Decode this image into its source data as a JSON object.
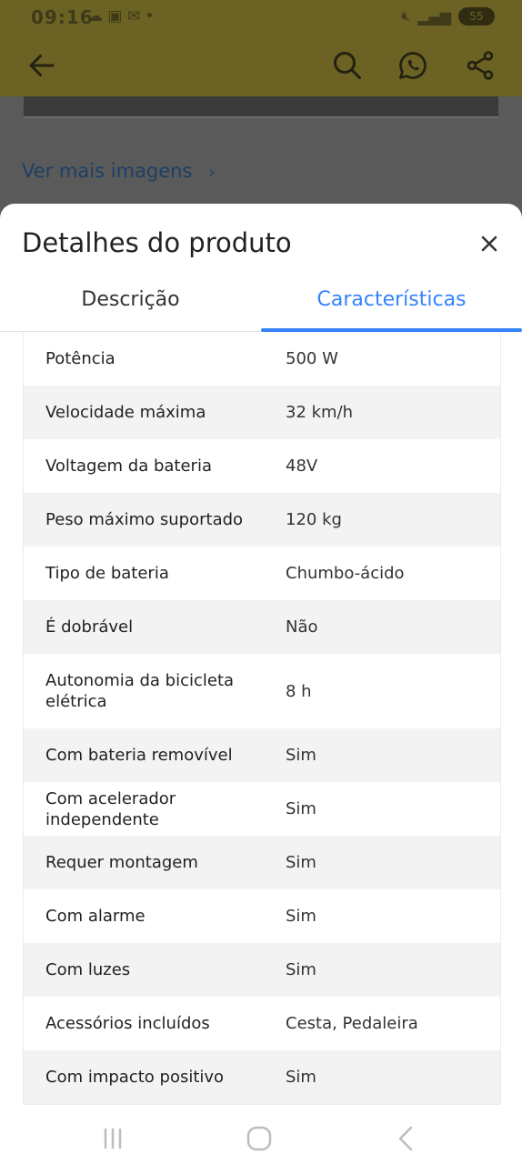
{
  "status_bar": {
    "time": "09:16",
    "notification_icons": [
      "cloud-icon",
      "image-icon",
      "mail-icon",
      "dot-icon"
    ],
    "battery": "55"
  },
  "app_bar": {
    "icons": [
      "back-arrow-icon",
      "search-icon",
      "whatsapp-icon",
      "share-icon"
    ]
  },
  "see_more_images": "Ver mais imagens",
  "sheet": {
    "title": "Detalhes do produto",
    "tabs": [
      {
        "label": "Descrição",
        "selected": false
      },
      {
        "label": "Características",
        "selected": true
      }
    ],
    "specs": [
      {
        "key": "Potência",
        "value": "500 W"
      },
      {
        "key": "Velocidade máxima",
        "value": "32 km/h"
      },
      {
        "key": "Voltagem da bateria",
        "value": "48V"
      },
      {
        "key": "Peso máximo suportado",
        "value": "120 kg"
      },
      {
        "key": "Tipo de bateria",
        "value": "Chumbo-ácido"
      },
      {
        "key": "É dobrável",
        "value": "Não"
      },
      {
        "key": "Autonomia da bicicleta elétrica",
        "value": "8 h"
      },
      {
        "key": "Com bateria removível",
        "value": "Sim"
      },
      {
        "key": "Com acelerador independente",
        "value": "Sim"
      },
      {
        "key": "Requer montagem",
        "value": "Sim"
      },
      {
        "key": "Com alarme",
        "value": "Sim"
      },
      {
        "key": "Com luzes",
        "value": "Sim"
      },
      {
        "key": "Acessórios incluídos",
        "value": "Cesta, Pedaleira"
      },
      {
        "key": "Com impacto positivo",
        "value": "Sim"
      }
    ]
  },
  "colors": {
    "accent": "#3483fa",
    "header_dimmed": "#6b6224",
    "link_dimmed": "#1d3f66"
  },
  "nav_bar": {
    "icons": [
      "recents-icon",
      "home-icon",
      "back-icon"
    ]
  }
}
